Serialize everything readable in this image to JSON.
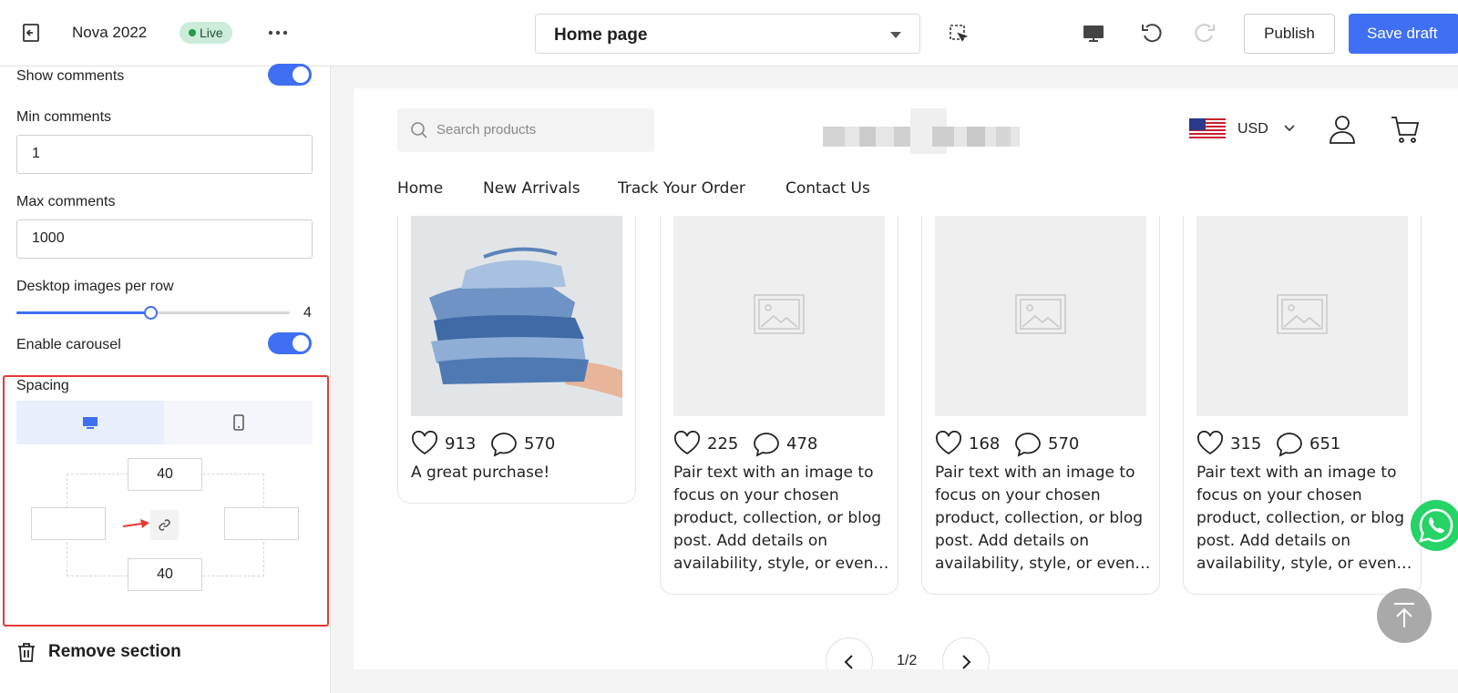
{
  "topbar": {
    "store_name": "Nova 2022",
    "status_badge": "Live",
    "page_selector": "Home page",
    "publish_label": "Publish",
    "save_label": "Save draft"
  },
  "panel": {
    "show_comments_label": "Show comments",
    "show_comments_on": true,
    "min_comments_label": "Min comments",
    "min_comments_value": "1",
    "max_comments_label": "Max comments",
    "max_comments_value": "1000",
    "images_per_row_label": "Desktop images per row",
    "images_per_row_value": "4",
    "images_per_row_fraction": 0.49,
    "enable_carousel_label": "Enable carousel",
    "enable_carousel_on": true,
    "spacing": {
      "title": "Spacing",
      "active_device": "desktop",
      "top": "40",
      "bottom": "40",
      "left": "",
      "right": ""
    },
    "remove_label": "Remove section"
  },
  "preview": {
    "search_placeholder": "Search products",
    "currency": "USD",
    "nav": [
      "Home",
      "New Arrivals",
      "Track Your Order",
      "Contact Us"
    ],
    "cards": [
      {
        "likes": "913",
        "comments": "570",
        "caption": "A great purchase!",
        "image": "jeans-photo"
      },
      {
        "likes": "225",
        "comments": "478",
        "caption": "Pair text with an image to focus on your chosen product, collection, or blog post. Add details on availability, style, or even…",
        "image": "placeholder"
      },
      {
        "likes": "168",
        "comments": "570",
        "caption": "Pair text with an image to focus on your chosen product, collection, or blog post. Add details on availability, style, or even…",
        "image": "placeholder"
      },
      {
        "likes": "315",
        "comments": "651",
        "caption": "Pair text with an image to focus on your chosen product, collection, or blog post. Add details on availability, style, or even…",
        "image": "placeholder"
      }
    ],
    "pager": "1/2"
  },
  "colors": {
    "accent": "#3f6ff2",
    "live_badge": "#cdebd9",
    "highlight_border": "#e53935",
    "whatsapp": "#25d366"
  }
}
